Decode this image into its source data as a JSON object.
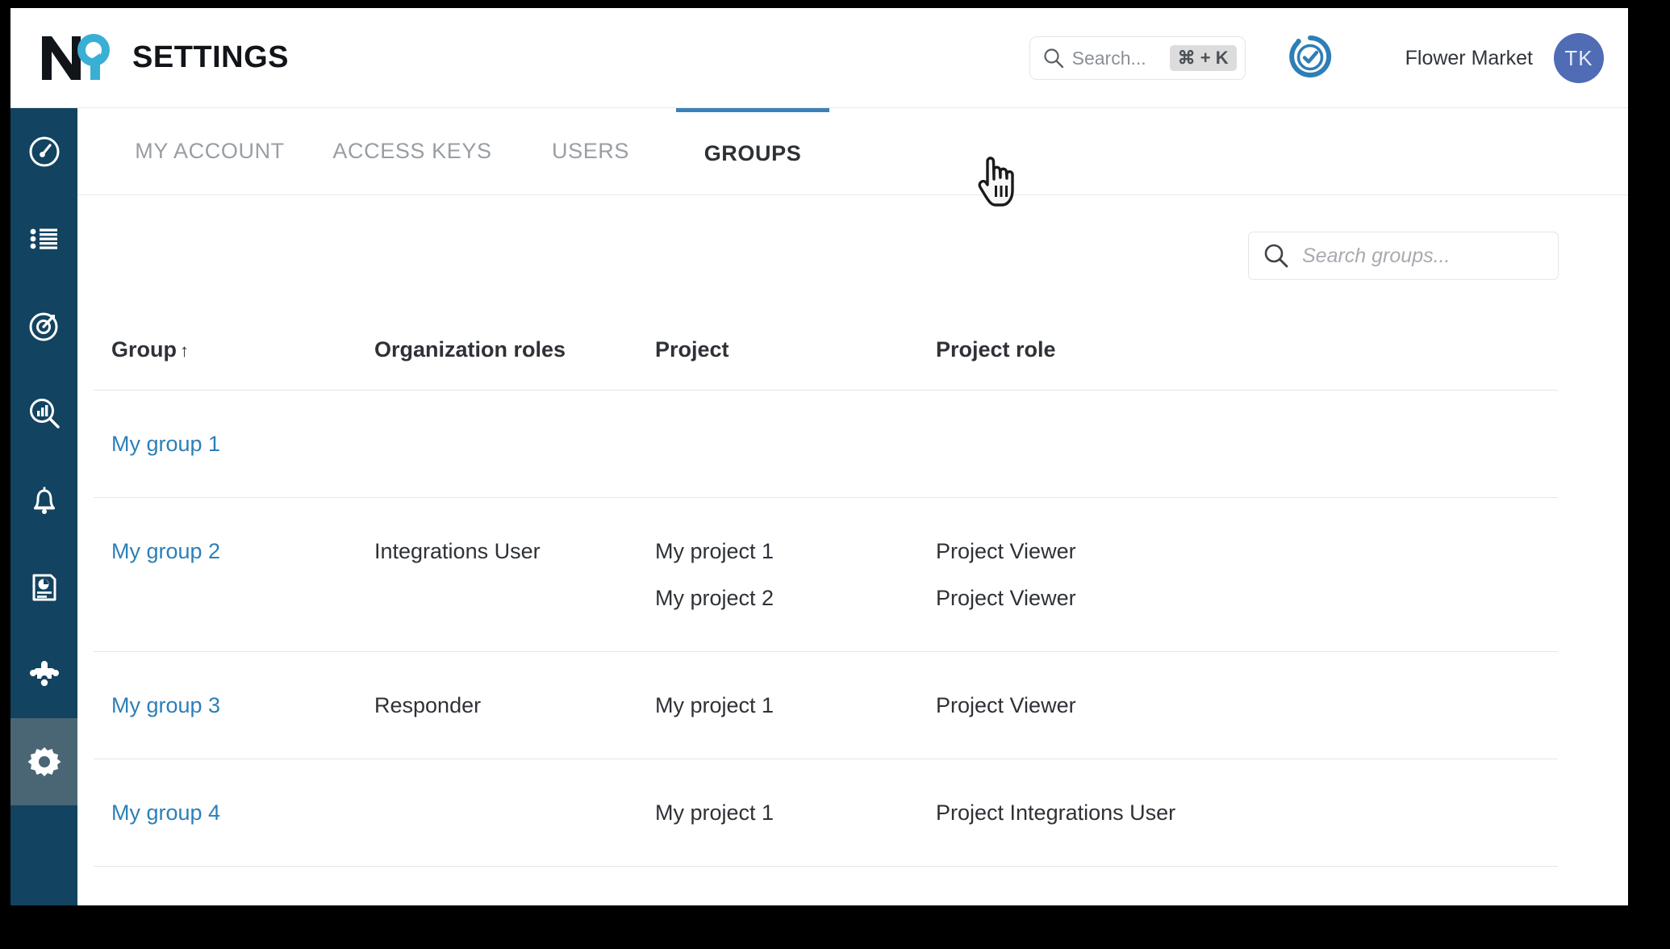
{
  "header": {
    "logo_text": "N9",
    "app_title": "SETTINGS",
    "search": {
      "placeholder": "Search...",
      "shortcut": "⌘ + K"
    },
    "status_icon": "status-check-icon",
    "org_name": "Flower Market",
    "avatar_initials": "TK"
  },
  "sidebar": {
    "items": [
      {
        "name": "sidebar-item-service-health",
        "icon": "gauge-icon",
        "active": false
      },
      {
        "name": "sidebar-item-catalog",
        "icon": "list-icon",
        "active": false
      },
      {
        "name": "sidebar-item-slo",
        "icon": "target-icon",
        "active": false
      },
      {
        "name": "sidebar-item-reports",
        "icon": "chart-search-icon",
        "active": false
      },
      {
        "name": "sidebar-item-alerts",
        "icon": "bell-icon",
        "active": false
      },
      {
        "name": "sidebar-item-documents",
        "icon": "report-document-icon",
        "active": false
      },
      {
        "name": "sidebar-item-integrations",
        "icon": "puzzle-icon",
        "active": false
      },
      {
        "name": "sidebar-item-settings",
        "icon": "gear-icon",
        "active": true
      }
    ]
  },
  "tabs": [
    {
      "label": "MY ACCOUNT",
      "active": false
    },
    {
      "label": "ACCESS KEYS",
      "active": false
    },
    {
      "label": "USERS",
      "active": false
    },
    {
      "label": "GROUPS",
      "active": true
    }
  ],
  "content": {
    "search_groups": {
      "placeholder": "Search groups...",
      "value": ""
    },
    "table": {
      "columns": [
        {
          "label": "Group",
          "sort": "↑"
        },
        {
          "label": "Organization roles",
          "sort": ""
        },
        {
          "label": "Project",
          "sort": ""
        },
        {
          "label": "Project role",
          "sort": ""
        }
      ],
      "rows": [
        {
          "group": "My group 1",
          "org_roles": [
            ""
          ],
          "projects": [
            ""
          ],
          "project_roles": [
            ""
          ]
        },
        {
          "group": "My group 2",
          "org_roles": [
            "Integrations User"
          ],
          "projects": [
            "My project 1",
            "My project 2"
          ],
          "project_roles": [
            "Project Viewer",
            "Project Viewer"
          ]
        },
        {
          "group": "My group 3",
          "org_roles": [
            "Responder"
          ],
          "projects": [
            "My project 1"
          ],
          "project_roles": [
            "Project Viewer"
          ]
        },
        {
          "group": "My group 4",
          "org_roles": [
            ""
          ],
          "projects": [
            "My project 1"
          ],
          "project_roles": [
            "Project Integrations User"
          ]
        }
      ]
    }
  },
  "cursor": {
    "type": "pointing-hand-cursor"
  },
  "colors": {
    "sidebar_bg": "#124360",
    "sidebar_active_bg": "#4a6674",
    "accent_blue": "#3a81b8",
    "link_blue": "#2c7fb8",
    "logo_cyan": "#3aafd4",
    "avatar_bg": "#4f6cb5",
    "status_blue": "#2e7fb5"
  }
}
